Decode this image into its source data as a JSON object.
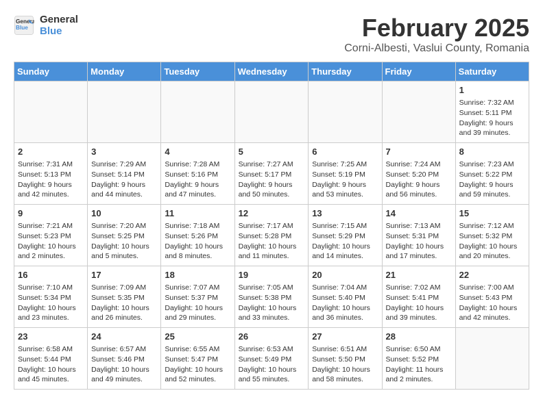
{
  "header": {
    "logo_line1": "General",
    "logo_line2": "Blue",
    "month": "February 2025",
    "location": "Corni-Albesti, Vaslui County, Romania"
  },
  "days_of_week": [
    "Sunday",
    "Monday",
    "Tuesday",
    "Wednesday",
    "Thursday",
    "Friday",
    "Saturday"
  ],
  "weeks": [
    [
      {
        "day": "",
        "info": ""
      },
      {
        "day": "",
        "info": ""
      },
      {
        "day": "",
        "info": ""
      },
      {
        "day": "",
        "info": ""
      },
      {
        "day": "",
        "info": ""
      },
      {
        "day": "",
        "info": ""
      },
      {
        "day": "1",
        "info": "Sunrise: 7:32 AM\nSunset: 5:11 PM\nDaylight: 9 hours and 39 minutes."
      }
    ],
    [
      {
        "day": "2",
        "info": "Sunrise: 7:31 AM\nSunset: 5:13 PM\nDaylight: 9 hours and 42 minutes."
      },
      {
        "day": "3",
        "info": "Sunrise: 7:29 AM\nSunset: 5:14 PM\nDaylight: 9 hours and 44 minutes."
      },
      {
        "day": "4",
        "info": "Sunrise: 7:28 AM\nSunset: 5:16 PM\nDaylight: 9 hours and 47 minutes."
      },
      {
        "day": "5",
        "info": "Sunrise: 7:27 AM\nSunset: 5:17 PM\nDaylight: 9 hours and 50 minutes."
      },
      {
        "day": "6",
        "info": "Sunrise: 7:25 AM\nSunset: 5:19 PM\nDaylight: 9 hours and 53 minutes."
      },
      {
        "day": "7",
        "info": "Sunrise: 7:24 AM\nSunset: 5:20 PM\nDaylight: 9 hours and 56 minutes."
      },
      {
        "day": "8",
        "info": "Sunrise: 7:23 AM\nSunset: 5:22 PM\nDaylight: 9 hours and 59 minutes."
      }
    ],
    [
      {
        "day": "9",
        "info": "Sunrise: 7:21 AM\nSunset: 5:23 PM\nDaylight: 10 hours and 2 minutes."
      },
      {
        "day": "10",
        "info": "Sunrise: 7:20 AM\nSunset: 5:25 PM\nDaylight: 10 hours and 5 minutes."
      },
      {
        "day": "11",
        "info": "Sunrise: 7:18 AM\nSunset: 5:26 PM\nDaylight: 10 hours and 8 minutes."
      },
      {
        "day": "12",
        "info": "Sunrise: 7:17 AM\nSunset: 5:28 PM\nDaylight: 10 hours and 11 minutes."
      },
      {
        "day": "13",
        "info": "Sunrise: 7:15 AM\nSunset: 5:29 PM\nDaylight: 10 hours and 14 minutes."
      },
      {
        "day": "14",
        "info": "Sunrise: 7:13 AM\nSunset: 5:31 PM\nDaylight: 10 hours and 17 minutes."
      },
      {
        "day": "15",
        "info": "Sunrise: 7:12 AM\nSunset: 5:32 PM\nDaylight: 10 hours and 20 minutes."
      }
    ],
    [
      {
        "day": "16",
        "info": "Sunrise: 7:10 AM\nSunset: 5:34 PM\nDaylight: 10 hours and 23 minutes."
      },
      {
        "day": "17",
        "info": "Sunrise: 7:09 AM\nSunset: 5:35 PM\nDaylight: 10 hours and 26 minutes."
      },
      {
        "day": "18",
        "info": "Sunrise: 7:07 AM\nSunset: 5:37 PM\nDaylight: 10 hours and 29 minutes."
      },
      {
        "day": "19",
        "info": "Sunrise: 7:05 AM\nSunset: 5:38 PM\nDaylight: 10 hours and 33 minutes."
      },
      {
        "day": "20",
        "info": "Sunrise: 7:04 AM\nSunset: 5:40 PM\nDaylight: 10 hours and 36 minutes."
      },
      {
        "day": "21",
        "info": "Sunrise: 7:02 AM\nSunset: 5:41 PM\nDaylight: 10 hours and 39 minutes."
      },
      {
        "day": "22",
        "info": "Sunrise: 7:00 AM\nSunset: 5:43 PM\nDaylight: 10 hours and 42 minutes."
      }
    ],
    [
      {
        "day": "23",
        "info": "Sunrise: 6:58 AM\nSunset: 5:44 PM\nDaylight: 10 hours and 45 minutes."
      },
      {
        "day": "24",
        "info": "Sunrise: 6:57 AM\nSunset: 5:46 PM\nDaylight: 10 hours and 49 minutes."
      },
      {
        "day": "25",
        "info": "Sunrise: 6:55 AM\nSunset: 5:47 PM\nDaylight: 10 hours and 52 minutes."
      },
      {
        "day": "26",
        "info": "Sunrise: 6:53 AM\nSunset: 5:49 PM\nDaylight: 10 hours and 55 minutes."
      },
      {
        "day": "27",
        "info": "Sunrise: 6:51 AM\nSunset: 5:50 PM\nDaylight: 10 hours and 58 minutes."
      },
      {
        "day": "28",
        "info": "Sunrise: 6:50 AM\nSunset: 5:52 PM\nDaylight: 11 hours and 2 minutes."
      },
      {
        "day": "",
        "info": ""
      }
    ]
  ]
}
